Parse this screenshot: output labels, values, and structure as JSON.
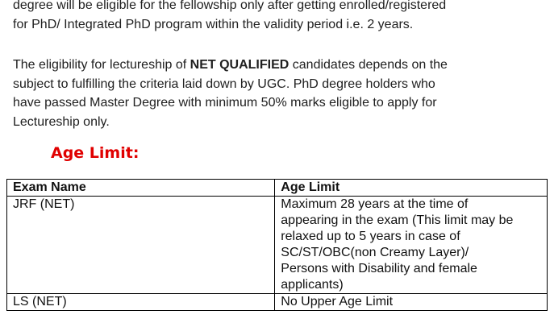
{
  "para1": {
    "lines": [
      "degree will be eligible for the fellowship only after getting enrolled/registered",
      "for PhD/ Integrated PhD program within the validity period i.e. 2 years."
    ]
  },
  "para2": {
    "line1_pre": "The eligibility for lectureship of ",
    "line1_bold": "NET QUALIFIED",
    "line1_post": " candidates depends on the",
    "line2": "subject to fulfilling the criteria laid down by UGC. PhD degree holders who",
    "line3": "have passed Master Degree with minimum 50% marks eligible to apply for",
    "line4": "Lectureship only."
  },
  "heading": "Age Limit:",
  "table": {
    "headers": [
      "Exam Name",
      "Age Limit"
    ],
    "rows": [
      {
        "exam": "JRF (NET)",
        "limit_lines": [
          "Maximum 28 years at the time of",
          "appearing in the exam (This limit may be",
          "relaxed up to 5 years in case of",
          "SC/ST/OBC(non Creamy Layer)/",
          "Persons with Disability and female",
          "applicants)"
        ]
      },
      {
        "exam": "LS (NET)",
        "limit_lines": [
          "No Upper Age Limit"
        ]
      }
    ]
  }
}
